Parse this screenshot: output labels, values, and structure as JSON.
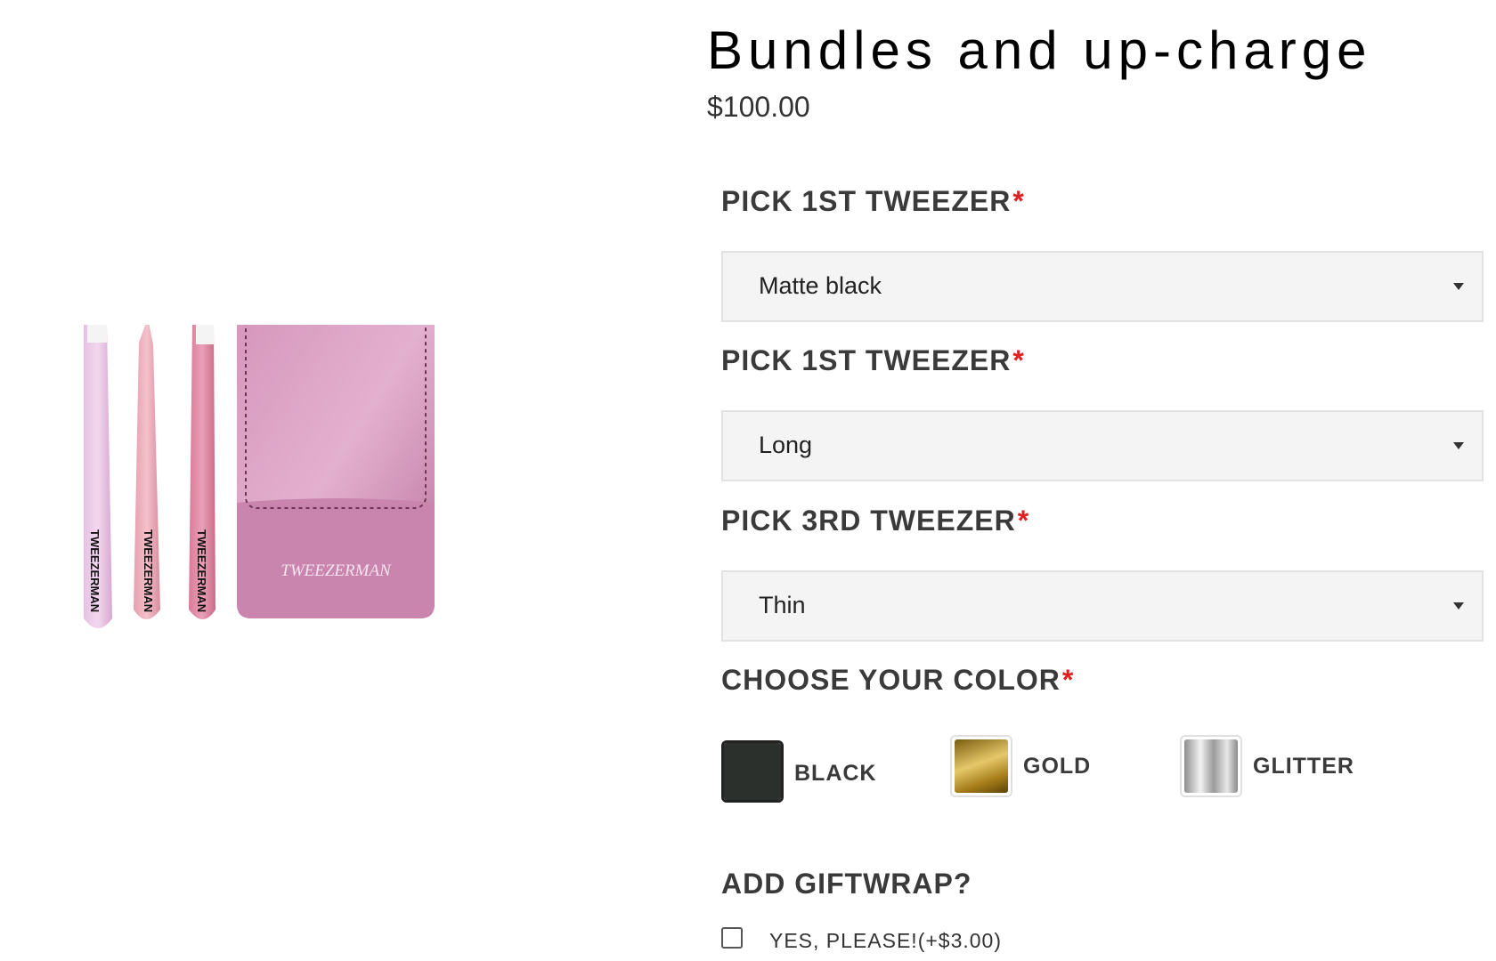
{
  "product": {
    "title": "Bundles and up-charge",
    "price": "$100.00",
    "image_alt": "Tweezerman tweezer set with pink leather case",
    "brand_mark": "TWEEZERMAN"
  },
  "options": [
    {
      "label": "PICK 1ST TWEEZER",
      "required_mark": "*",
      "selected_value": "Matte black"
    },
    {
      "label": "PICK 1ST TWEEZER",
      "required_mark": "*",
      "selected_value": "Long"
    },
    {
      "label": "PICK 3RD TWEEZER",
      "required_mark": "*",
      "selected_value": "Thin"
    }
  ],
  "color_picker": {
    "label": "CHOOSE YOUR COLOR",
    "required_mark": "*",
    "swatches": [
      {
        "name": "BLACK",
        "color": "#2c302d",
        "selected": true
      },
      {
        "name": "GOLD",
        "color": "#b8922a",
        "selected": false
      },
      {
        "name": "GLITTER",
        "color": "#c4c4c4",
        "selected": false
      }
    ]
  },
  "giftwrap": {
    "label": "ADD GIFTWRAP?",
    "option_label": "YES, PLEASE!(+$3.00)",
    "checked": false
  },
  "colors": {
    "required": "#e02020",
    "select_bg": "#f4f4f4"
  }
}
